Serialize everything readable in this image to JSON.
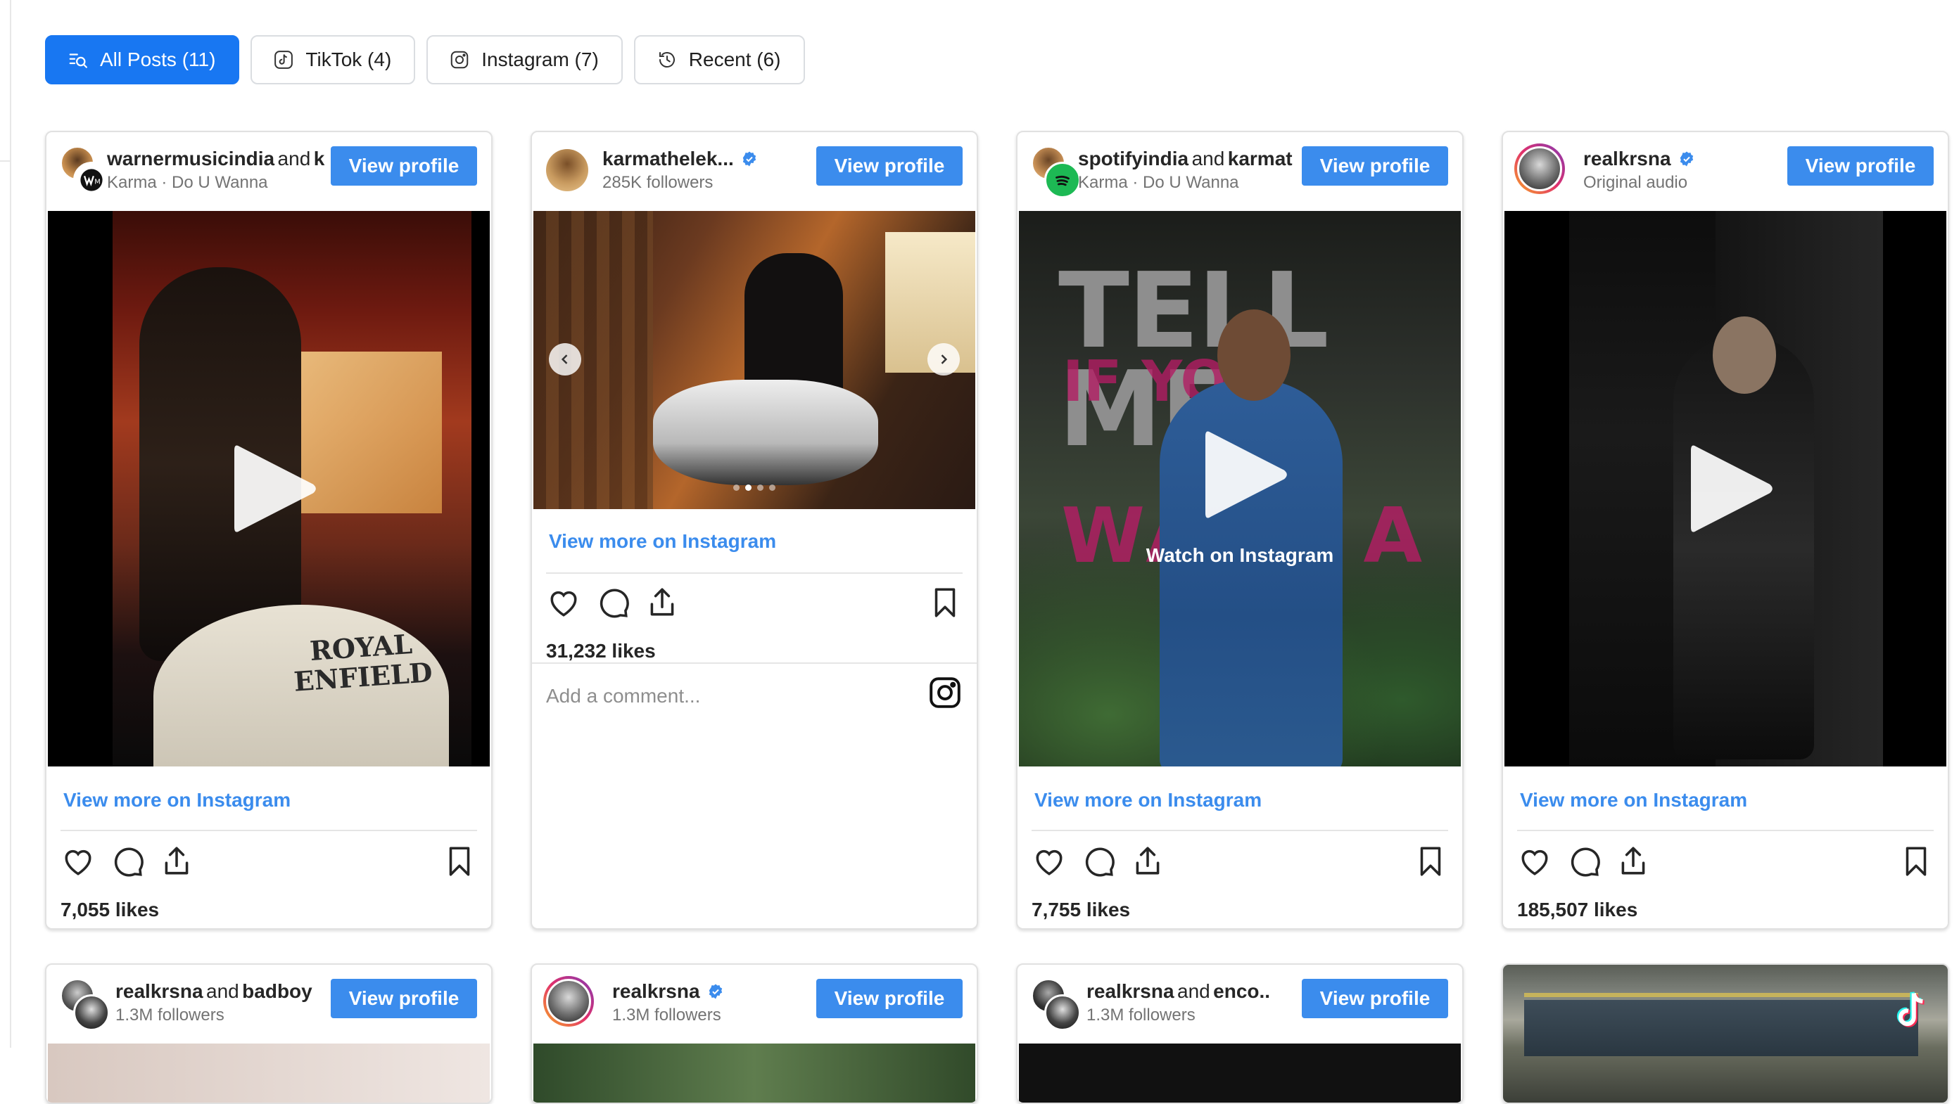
{
  "filters": [
    {
      "label": "All Posts (11)",
      "icon": "search-list-icon",
      "active": true
    },
    {
      "label": "TikTok (4)",
      "icon": "tiktok-icon"
    },
    {
      "label": "Instagram (7)",
      "icon": "instagram-icon"
    },
    {
      "label": "Recent (6)",
      "icon": "history-icon"
    }
  ],
  "common": {
    "view_profile": "View profile",
    "view_more": "View more on Instagram",
    "and": "and",
    "add_comment": "Add a comment...",
    "watch_on_instagram": "Watch on Instagram"
  },
  "cards": [
    {
      "user": "warnermusicindia",
      "collab": "k",
      "subtitle": "Karma · Do U Wanna",
      "likes": "7,055 likes",
      "media_text": {
        "line1": "ROYAL",
        "line2": "ENFIELD"
      }
    },
    {
      "user": "karmathelek...",
      "subtitle": "285K followers",
      "likes": "31,232 likes",
      "verified": true
    },
    {
      "user": "spotifyindia",
      "collab": "karmat",
      "subtitle": "Karma · Do U Wanna",
      "likes": "7,755 likes",
      "media_text": {
        "line1": "TELL ME,",
        "line2": "IF YOU",
        "line3": "WANT A"
      }
    },
    {
      "user": "realkrsna",
      "subtitle": "Original audio",
      "likes": "185,507 likes",
      "verified": true
    }
  ],
  "cards_row2": [
    {
      "user": "realkrsna",
      "collab": "badboy",
      "subtitle": "1.3M followers"
    },
    {
      "user": "realkrsna",
      "subtitle": "1.3M followers",
      "verified": true
    },
    {
      "user": "realkrsna",
      "collab": "enco..",
      "subtitle": "1.3M followers"
    },
    {
      "platform": "TikTok"
    }
  ],
  "colors": {
    "accent": "#1877f2",
    "button": "#3b8ced",
    "link": "#3b8ced"
  }
}
